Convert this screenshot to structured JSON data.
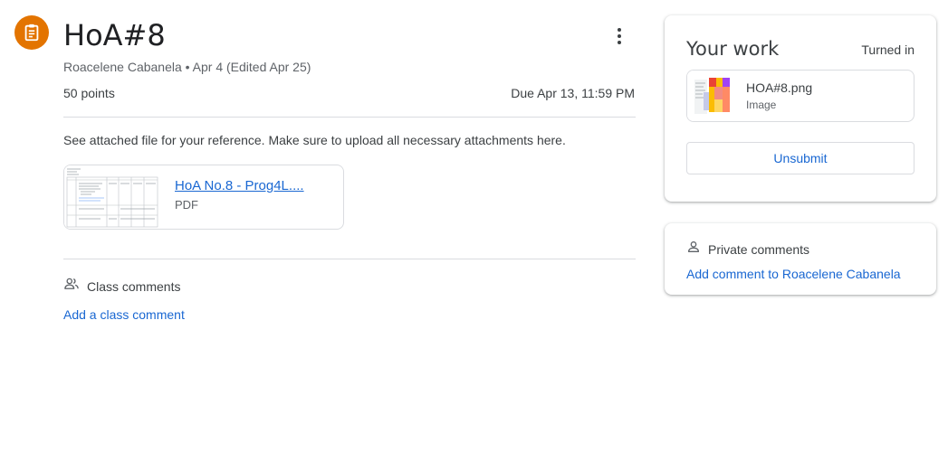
{
  "assignment": {
    "title": "HoA#8",
    "meta": "Roacelene Cabanela • Apr 4 (Edited Apr 25)",
    "points": "50 points",
    "due": "Due Apr 13, 11:59 PM",
    "description": "See attached file for your reference. Make sure to upload all necessary attachments here.",
    "icon": "assignment-icon",
    "accent_color": "#e37400"
  },
  "attachment": {
    "title": "HoA No.8 - Prog4L....",
    "type": "PDF"
  },
  "class_comments": {
    "label": "Class comments",
    "add_link": "Add a class comment"
  },
  "your_work": {
    "title": "Your work",
    "status": "Turned in",
    "file": {
      "name": "HOA#8.png",
      "type": "Image"
    },
    "unsubmit_label": "Unsubmit"
  },
  "private_comments": {
    "label": "Private comments",
    "add_link": "Add comment to Roacelene Cabanela"
  },
  "colors": {
    "link": "#1967d2",
    "divider": "#dadce0"
  }
}
